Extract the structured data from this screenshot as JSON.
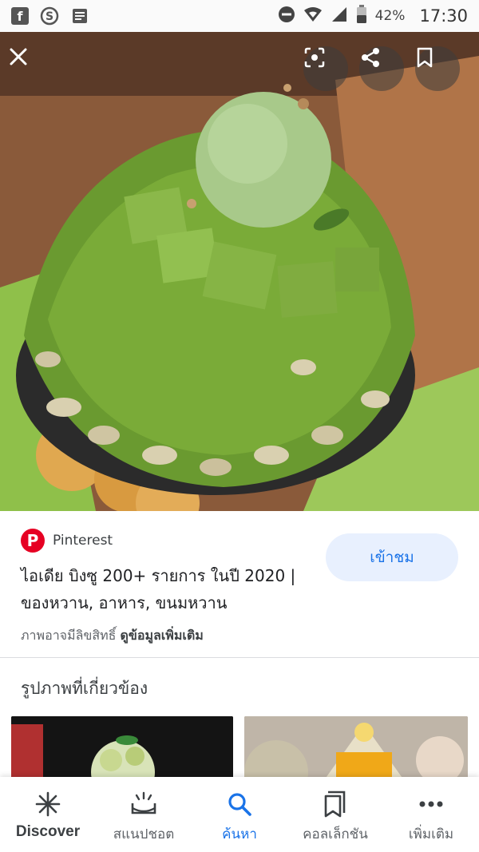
{
  "status_bar": {
    "left_icons": [
      "facebook-icon",
      "skype-icon",
      "news-icon"
    ],
    "battery": "42%",
    "time": "17:30"
  },
  "viewer": {
    "icons": [
      "close-icon",
      "lens-icon",
      "share-icon",
      "bookmark-icon"
    ]
  },
  "result": {
    "source": "Pinterest",
    "title": "ไอเดีย บิงซู 200+ รายการ ในปี 2020 | ของหวาน, อาหาร, ขนมหวาน",
    "visit_label": "เข้าชม",
    "copyright_text": "ภาพอาจมีลิขสิทธิ์",
    "more_info_label": "ดูข้อมูลเพิ่มเติม",
    "accent": "#1a73e8",
    "brand_color": "#e60023"
  },
  "related": {
    "title": "รูปภาพที่เกี่ยวข้อง"
  },
  "bottom_nav": [
    {
      "label": "Discover",
      "icon": "asterisk-icon"
    },
    {
      "label": "สแนปชอต",
      "icon": "snapshot-icon"
    },
    {
      "label": "ค้นหา",
      "icon": "search-icon"
    },
    {
      "label": "คอลเล็กชัน",
      "icon": "collections-icon"
    },
    {
      "label": "เพิ่มเติม",
      "icon": "more-icon"
    }
  ]
}
